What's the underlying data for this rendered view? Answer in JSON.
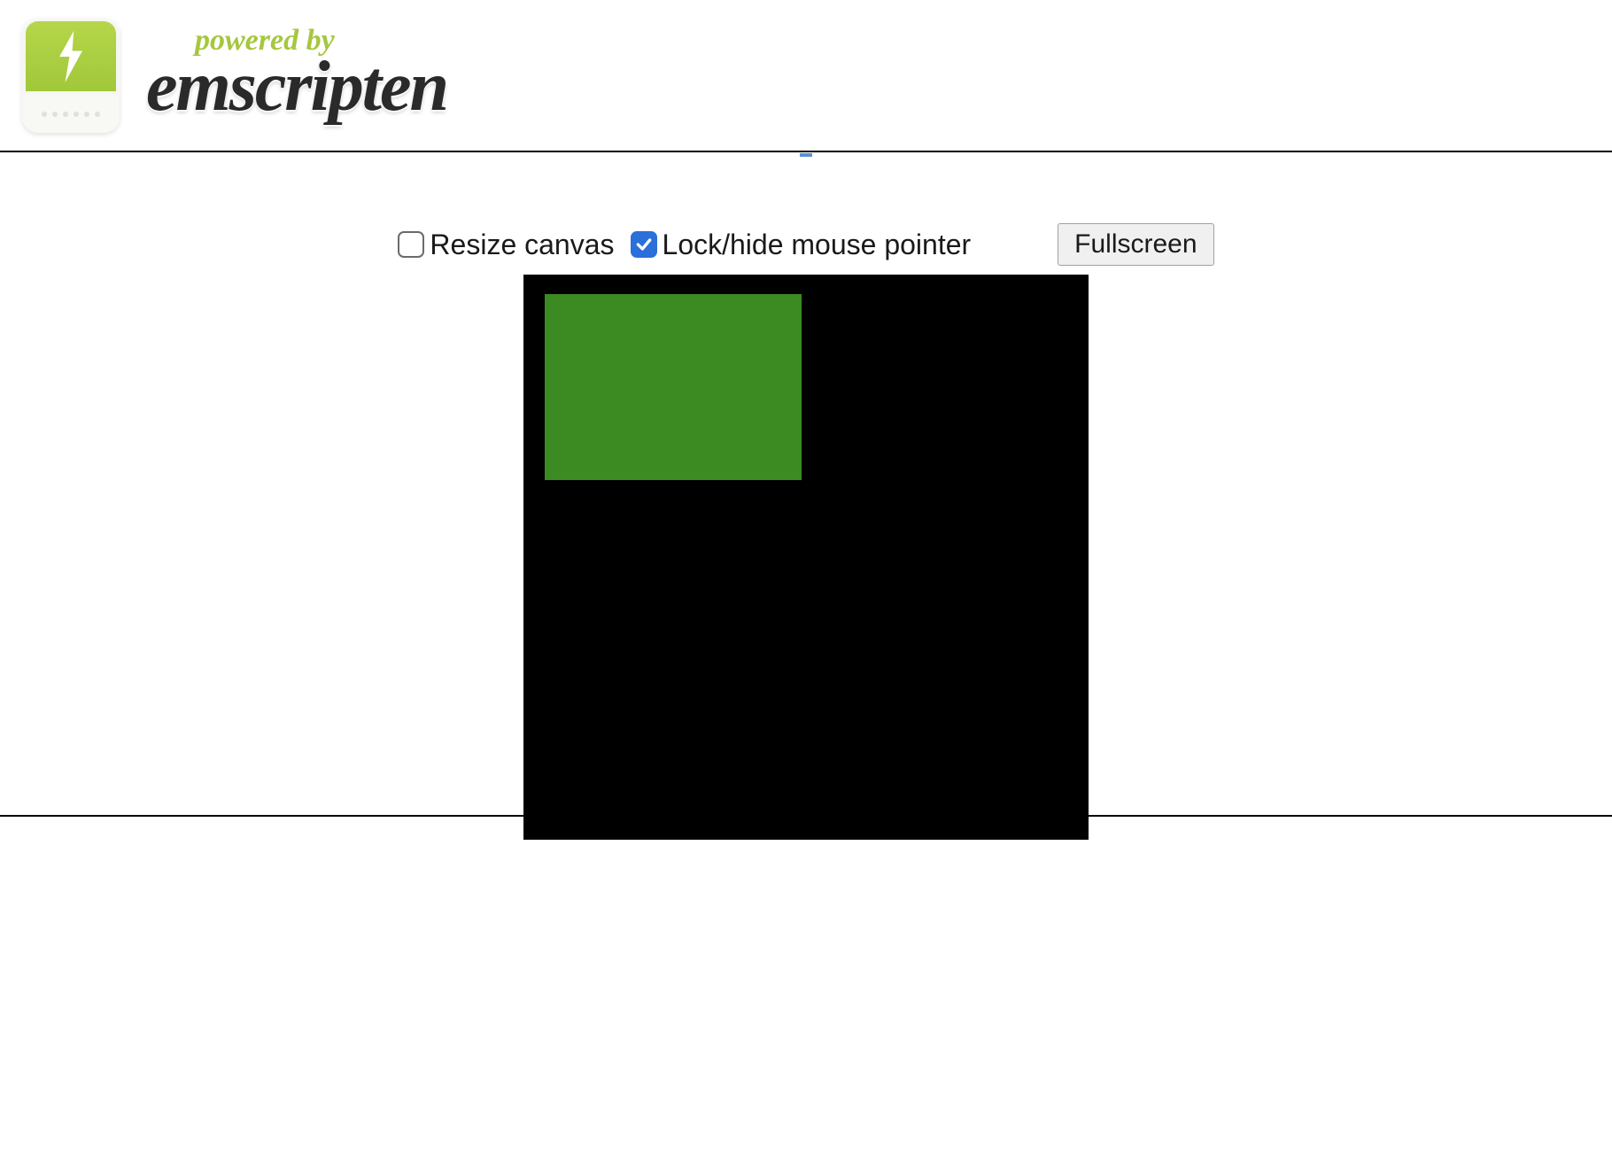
{
  "header": {
    "powered_by": "powered by",
    "brand": "emscripten"
  },
  "controls": {
    "resize_checkbox": {
      "label": "Resize canvas",
      "checked": false
    },
    "pointer_checkbox": {
      "label": "Lock/hide mouse pointer",
      "checked": true
    },
    "fullscreen_button": "Fullscreen"
  },
  "canvas": {
    "bg_color": "#000000",
    "rect_color": "#3b8a22"
  }
}
